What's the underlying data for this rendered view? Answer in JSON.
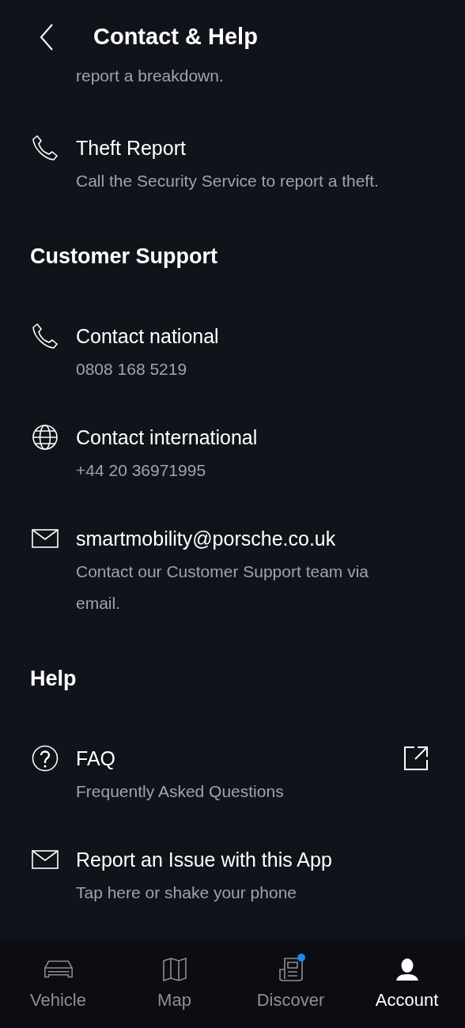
{
  "header": {
    "title": "Contact & Help"
  },
  "cut_line": "report a breakdown.",
  "sections": [
    {
      "items": [
        {
          "kind": "phone",
          "title": "Theft Report",
          "subtitle": "Call the Security Service to report a theft.",
          "external": false
        }
      ]
    },
    {
      "heading": "Customer Support",
      "items": [
        {
          "kind": "phone",
          "title": "Contact national",
          "subtitle": "0808 168 5219",
          "external": false
        },
        {
          "kind": "globe",
          "title": "Contact international",
          "subtitle": "+44 20 36971995",
          "external": false
        },
        {
          "kind": "mail",
          "title": "smartmobility@porsche.co.uk",
          "subtitle": "Contact our Customer Support team via email.",
          "external": false
        }
      ]
    },
    {
      "heading": "Help",
      "items": [
        {
          "kind": "question",
          "title": "FAQ",
          "subtitle": "Frequently Asked Questions",
          "external": true
        },
        {
          "kind": "mail",
          "title": "Report an Issue with this App",
          "subtitle": "Tap here or shake your phone",
          "external": false
        }
      ]
    }
  ],
  "nav": [
    {
      "kind": "car",
      "label": "Vehicle",
      "selected": false,
      "notification": false
    },
    {
      "kind": "map",
      "label": "Map",
      "selected": false,
      "notification": false
    },
    {
      "kind": "news",
      "label": "Discover",
      "selected": false,
      "notification": true
    },
    {
      "kind": "person",
      "label": "Account",
      "selected": true,
      "notification": false
    }
  ]
}
